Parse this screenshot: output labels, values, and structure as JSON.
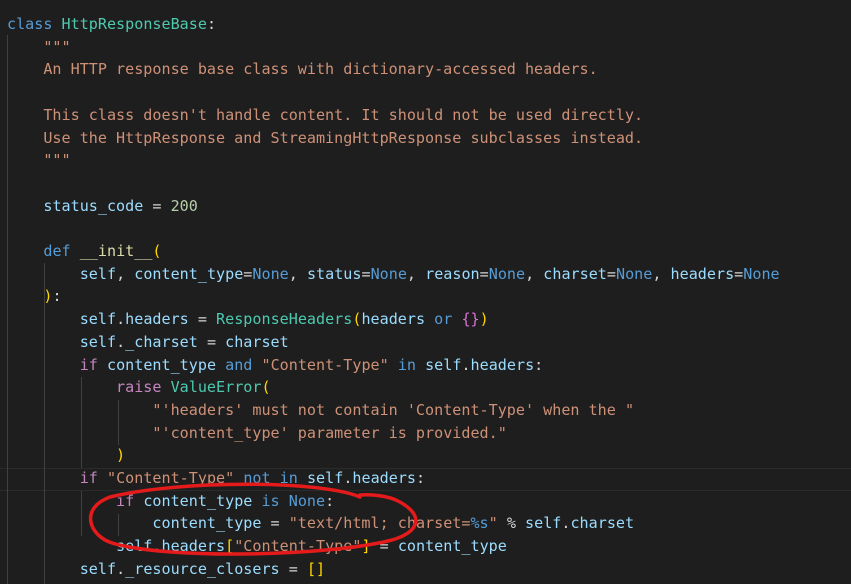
{
  "editor": {
    "annotation_color": "#e51b1b",
    "lines": [
      {
        "tokens": [
          {
            "c": "kw",
            "t": "class"
          },
          {
            "c": "op",
            "t": " "
          },
          {
            "c": "cls",
            "t": "HttpResponseBase"
          },
          {
            "c": "op",
            "t": ":"
          }
        ]
      },
      {
        "tokens": [
          {
            "c": "str",
            "t": "    \"\"\""
          }
        ]
      },
      {
        "tokens": [
          {
            "c": "str",
            "t": "    An HTTP response base class with dictionary-accessed headers."
          }
        ]
      },
      {
        "tokens": [
          {
            "c": "str",
            "t": ""
          }
        ]
      },
      {
        "tokens": [
          {
            "c": "str",
            "t": "    This class doesn't handle content. It should not be used directly."
          }
        ]
      },
      {
        "tokens": [
          {
            "c": "str",
            "t": "    Use the HttpResponse and StreamingHttpResponse subclasses instead."
          }
        ]
      },
      {
        "tokens": [
          {
            "c": "str",
            "t": "    \"\"\""
          }
        ]
      },
      {
        "tokens": [
          {
            "c": "op",
            "t": ""
          }
        ]
      },
      {
        "tokens": [
          {
            "c": "op",
            "t": "    "
          },
          {
            "c": "var",
            "t": "status_code"
          },
          {
            "c": "op",
            "t": " = "
          },
          {
            "c": "num",
            "t": "200"
          }
        ]
      },
      {
        "tokens": [
          {
            "c": "op",
            "t": ""
          }
        ]
      },
      {
        "tokens": [
          {
            "c": "op",
            "t": "    "
          },
          {
            "c": "kw",
            "t": "def"
          },
          {
            "c": "op",
            "t": " "
          },
          {
            "c": "fn",
            "t": "__init__"
          },
          {
            "c": "br1",
            "t": "("
          }
        ]
      },
      {
        "tokens": [
          {
            "c": "op",
            "t": "        "
          },
          {
            "c": "var",
            "t": "self"
          },
          {
            "c": "op",
            "t": ", "
          },
          {
            "c": "var",
            "t": "content_type"
          },
          {
            "c": "op",
            "t": "="
          },
          {
            "c": "kw",
            "t": "None"
          },
          {
            "c": "op",
            "t": ", "
          },
          {
            "c": "var",
            "t": "status"
          },
          {
            "c": "op",
            "t": "="
          },
          {
            "c": "kw",
            "t": "None"
          },
          {
            "c": "op",
            "t": ", "
          },
          {
            "c": "var",
            "t": "reason"
          },
          {
            "c": "op",
            "t": "="
          },
          {
            "c": "kw",
            "t": "None"
          },
          {
            "c": "op",
            "t": ", "
          },
          {
            "c": "var",
            "t": "charset"
          },
          {
            "c": "op",
            "t": "="
          },
          {
            "c": "kw",
            "t": "None"
          },
          {
            "c": "op",
            "t": ", "
          },
          {
            "c": "var",
            "t": "headers"
          },
          {
            "c": "op",
            "t": "="
          },
          {
            "c": "kw",
            "t": "None"
          }
        ]
      },
      {
        "tokens": [
          {
            "c": "op",
            "t": "    "
          },
          {
            "c": "br1",
            "t": ")"
          },
          {
            "c": "op",
            "t": ":"
          }
        ]
      },
      {
        "tokens": [
          {
            "c": "op",
            "t": "        "
          },
          {
            "c": "var",
            "t": "self"
          },
          {
            "c": "op",
            "t": "."
          },
          {
            "c": "var",
            "t": "headers"
          },
          {
            "c": "op",
            "t": " = "
          },
          {
            "c": "cls",
            "t": "ResponseHeaders"
          },
          {
            "c": "br1",
            "t": "("
          },
          {
            "c": "var",
            "t": "headers"
          },
          {
            "c": "op",
            "t": " "
          },
          {
            "c": "kw",
            "t": "or"
          },
          {
            "c": "op",
            "t": " "
          },
          {
            "c": "br2",
            "t": "{}"
          },
          {
            "c": "br1",
            "t": ")"
          }
        ]
      },
      {
        "tokens": [
          {
            "c": "op",
            "t": "        "
          },
          {
            "c": "var",
            "t": "self"
          },
          {
            "c": "op",
            "t": "."
          },
          {
            "c": "var",
            "t": "_charset"
          },
          {
            "c": "op",
            "t": " = "
          },
          {
            "c": "var",
            "t": "charset"
          }
        ]
      },
      {
        "tokens": [
          {
            "c": "op",
            "t": "        "
          },
          {
            "c": "ctl",
            "t": "if"
          },
          {
            "c": "op",
            "t": " "
          },
          {
            "c": "var",
            "t": "content_type"
          },
          {
            "c": "op",
            "t": " "
          },
          {
            "c": "kw",
            "t": "and"
          },
          {
            "c": "op",
            "t": " "
          },
          {
            "c": "str",
            "t": "\"Content-Type\""
          },
          {
            "c": "op",
            "t": " "
          },
          {
            "c": "kw",
            "t": "in"
          },
          {
            "c": "op",
            "t": " "
          },
          {
            "c": "var",
            "t": "self"
          },
          {
            "c": "op",
            "t": "."
          },
          {
            "c": "var",
            "t": "headers"
          },
          {
            "c": "op",
            "t": ":"
          }
        ]
      },
      {
        "tokens": [
          {
            "c": "op",
            "t": "            "
          },
          {
            "c": "ctl",
            "t": "raise"
          },
          {
            "c": "op",
            "t": " "
          },
          {
            "c": "cls",
            "t": "ValueError"
          },
          {
            "c": "br1",
            "t": "("
          }
        ]
      },
      {
        "tokens": [
          {
            "c": "op",
            "t": "                "
          },
          {
            "c": "str",
            "t": "\"'headers' must not contain 'Content-Type' when the \""
          }
        ]
      },
      {
        "tokens": [
          {
            "c": "op",
            "t": "                "
          },
          {
            "c": "str",
            "t": "\"'content_type' parameter is provided.\""
          }
        ]
      },
      {
        "tokens": [
          {
            "c": "op",
            "t": "            "
          },
          {
            "c": "br1",
            "t": ")"
          }
        ]
      },
      {
        "tokens": [
          {
            "c": "op",
            "t": "        "
          },
          {
            "c": "ctl",
            "t": "if"
          },
          {
            "c": "op",
            "t": " "
          },
          {
            "c": "str",
            "t": "\"Content-Type\""
          },
          {
            "c": "op",
            "t": " "
          },
          {
            "c": "kw",
            "t": "not"
          },
          {
            "c": "op",
            "t": " "
          },
          {
            "c": "kw",
            "t": "in"
          },
          {
            "c": "op",
            "t": " "
          },
          {
            "c": "var",
            "t": "self"
          },
          {
            "c": "op",
            "t": "."
          },
          {
            "c": "var",
            "t": "headers"
          },
          {
            "c": "op",
            "t": ":"
          }
        ]
      },
      {
        "tokens": [
          {
            "c": "op",
            "t": "            "
          },
          {
            "c": "ctl",
            "t": "if"
          },
          {
            "c": "op",
            "t": " "
          },
          {
            "c": "var",
            "t": "content_type"
          },
          {
            "c": "op",
            "t": " "
          },
          {
            "c": "kw",
            "t": "is"
          },
          {
            "c": "op",
            "t": " "
          },
          {
            "c": "kw",
            "t": "None"
          },
          {
            "c": "op",
            "t": ":"
          }
        ]
      },
      {
        "tokens": [
          {
            "c": "op",
            "t": "                "
          },
          {
            "c": "var",
            "t": "content_type"
          },
          {
            "c": "op",
            "t": " = "
          },
          {
            "c": "str",
            "t": "\"text/html; charset="
          },
          {
            "c": "fmt",
            "t": "%s"
          },
          {
            "c": "str",
            "t": "\""
          },
          {
            "c": "op",
            "t": " % "
          },
          {
            "c": "var",
            "t": "self"
          },
          {
            "c": "op",
            "t": "."
          },
          {
            "c": "var",
            "t": "charset"
          }
        ]
      },
      {
        "tokens": [
          {
            "c": "op",
            "t": "            "
          },
          {
            "c": "var",
            "t": "self"
          },
          {
            "c": "op",
            "t": "."
          },
          {
            "c": "var",
            "t": "headers"
          },
          {
            "c": "br1",
            "t": "["
          },
          {
            "c": "str",
            "t": "\"Content-Type\""
          },
          {
            "c": "br1",
            "t": "]"
          },
          {
            "c": "op",
            "t": " = "
          },
          {
            "c": "var",
            "t": "content_type"
          }
        ]
      },
      {
        "tokens": [
          {
            "c": "op",
            "t": "        "
          },
          {
            "c": "var",
            "t": "self"
          },
          {
            "c": "op",
            "t": "."
          },
          {
            "c": "var",
            "t": "_resource_closers"
          },
          {
            "c": "op",
            "t": " = "
          },
          {
            "c": "br1",
            "t": "[]"
          }
        ]
      }
    ]
  }
}
